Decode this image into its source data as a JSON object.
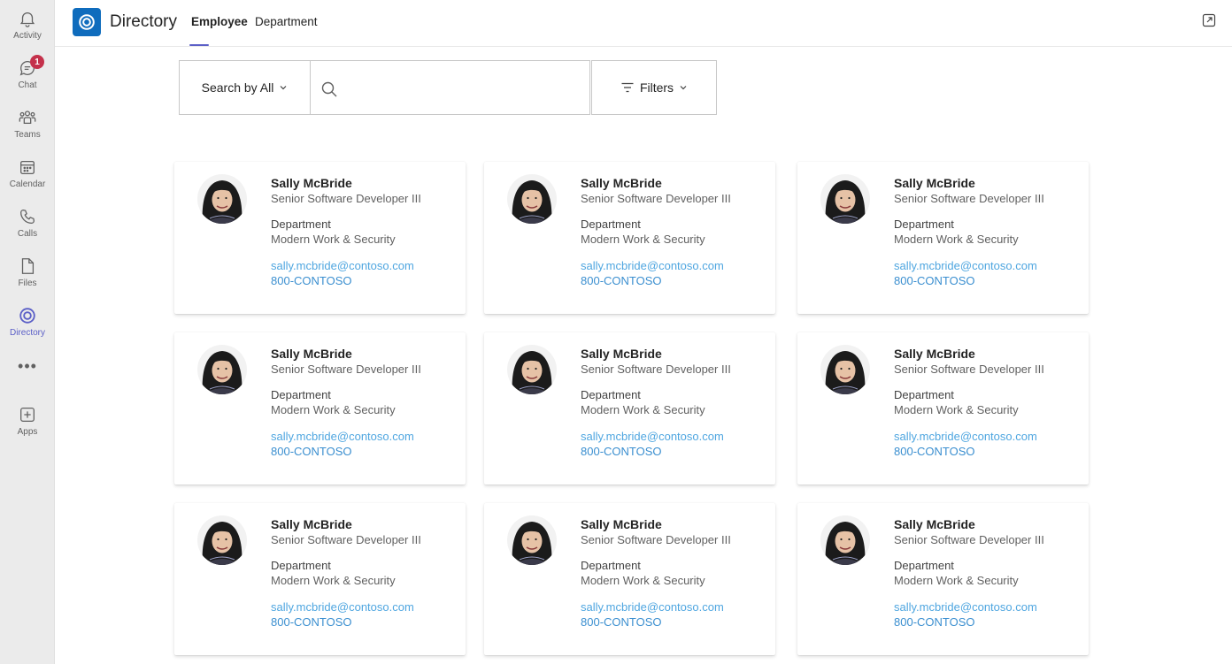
{
  "rail": {
    "items": [
      {
        "label": "Activity",
        "icon": "bell-icon"
      },
      {
        "label": "Chat",
        "icon": "chat-icon",
        "badge": "1"
      },
      {
        "label": "Teams",
        "icon": "teams-icon"
      },
      {
        "label": "Calendar",
        "icon": "calendar-icon"
      },
      {
        "label": "Calls",
        "icon": "phone-icon"
      },
      {
        "label": "Files",
        "icon": "file-icon"
      },
      {
        "label": "Directory",
        "icon": "directory-icon",
        "active": true
      },
      {
        "label": "Apps",
        "icon": "apps-icon"
      }
    ],
    "more": "•••"
  },
  "header": {
    "app_title": "Directory",
    "tabs": [
      {
        "label": "Employee",
        "active": true
      },
      {
        "label": "Department",
        "active": false
      }
    ]
  },
  "search": {
    "scope_label": "Search by All",
    "placeholder": "",
    "value": "",
    "filters_label": "Filters"
  },
  "colors": {
    "accent": "#5b5fc7",
    "brand": "#0f6cbd",
    "link": "#4fa6e0",
    "badge": "#c4314b"
  },
  "employees": [
    {
      "name": "Sally McBride",
      "title": "Senior Software Developer III",
      "department_label": "Department",
      "department": "Modern Work & Security",
      "email": "sally.mcbride@contoso.com",
      "phone": "800-CONTOSO"
    },
    {
      "name": "Sally McBride",
      "title": "Senior Software Developer III",
      "department_label": "Department",
      "department": "Modern Work & Security",
      "email": "sally.mcbride@contoso.com",
      "phone": "800-CONTOSO"
    },
    {
      "name": "Sally McBride",
      "title": "Senior Software Developer III",
      "department_label": "Department",
      "department": "Modern Work & Security",
      "email": "sally.mcbride@contoso.com",
      "phone": "800-CONTOSO"
    },
    {
      "name": "Sally McBride",
      "title": "Senior Software Developer III",
      "department_label": "Department",
      "department": "Modern Work & Security",
      "email": "sally.mcbride@contoso.com",
      "phone": "800-CONTOSO"
    },
    {
      "name": "Sally McBride",
      "title": "Senior Software Developer III",
      "department_label": "Department",
      "department": "Modern Work & Security",
      "email": "sally.mcbride@contoso.com",
      "phone": "800-CONTOSO"
    },
    {
      "name": "Sally McBride",
      "title": "Senior Software Developer III",
      "department_label": "Department",
      "department": "Modern Work & Security",
      "email": "sally.mcbride@contoso.com",
      "phone": "800-CONTOSO"
    },
    {
      "name": "Sally McBride",
      "title": "Senior Software Developer III",
      "department_label": "Department",
      "department": "Modern Work & Security",
      "email": "sally.mcbride@contoso.com",
      "phone": "800-CONTOSO"
    },
    {
      "name": "Sally McBride",
      "title": "Senior Software Developer III",
      "department_label": "Department",
      "department": "Modern Work & Security",
      "email": "sally.mcbride@contoso.com",
      "phone": "800-CONTOSO"
    },
    {
      "name": "Sally McBride",
      "title": "Senior Software Developer III",
      "department_label": "Department",
      "department": "Modern Work & Security",
      "email": "sally.mcbride@contoso.com",
      "phone": "800-CONTOSO"
    }
  ]
}
